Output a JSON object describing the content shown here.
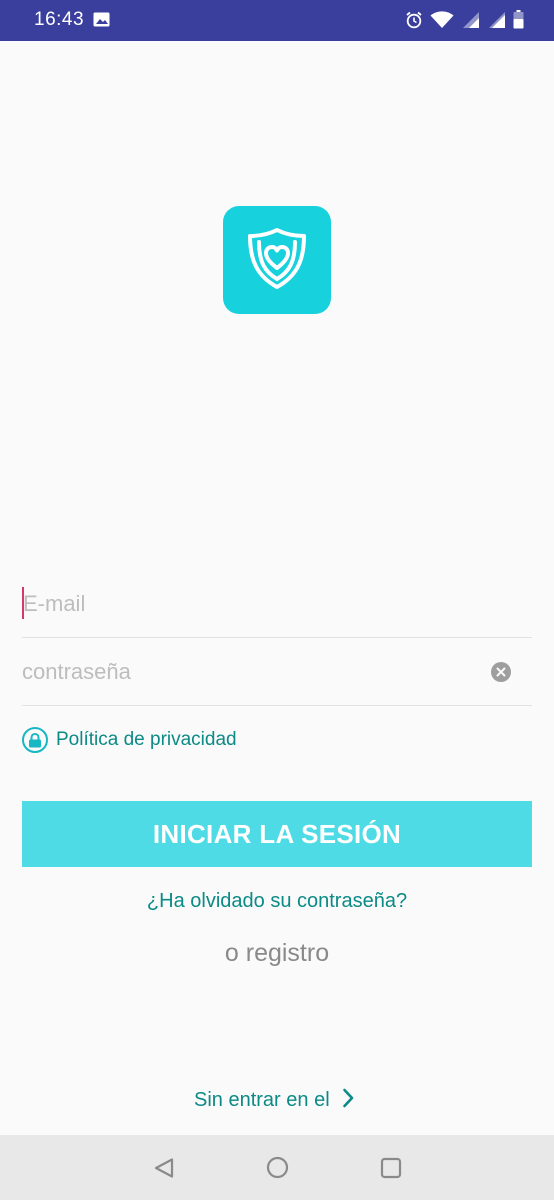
{
  "status_bar": {
    "time": "16:43",
    "icons": [
      "image-icon",
      "alarm-icon",
      "wifi-icon",
      "signal-icon",
      "signal-icon",
      "battery-icon"
    ],
    "background": "#3a3f9e"
  },
  "logo": {
    "icon": "shield-heart-icon",
    "color": "#17d1dd"
  },
  "form": {
    "email_placeholder": "E-mail",
    "email_value": "",
    "password_placeholder": "contraseña",
    "password_value": ""
  },
  "privacy": {
    "icon": "lock-icon",
    "label": "Política de privacidad"
  },
  "login_button": {
    "label": "INICIAR LA SESIÓN",
    "color": "#4fdbe5"
  },
  "links": {
    "forgot_password": "¿Ha olvidado su contraseña?",
    "register": "o registro",
    "skip": "Sin entrar en el"
  },
  "nav_bar": {
    "icons": [
      "back-icon",
      "home-icon",
      "recent-apps-icon"
    ]
  },
  "colors": {
    "accent_text": "#0b8a86",
    "caret": "#d6386c"
  }
}
